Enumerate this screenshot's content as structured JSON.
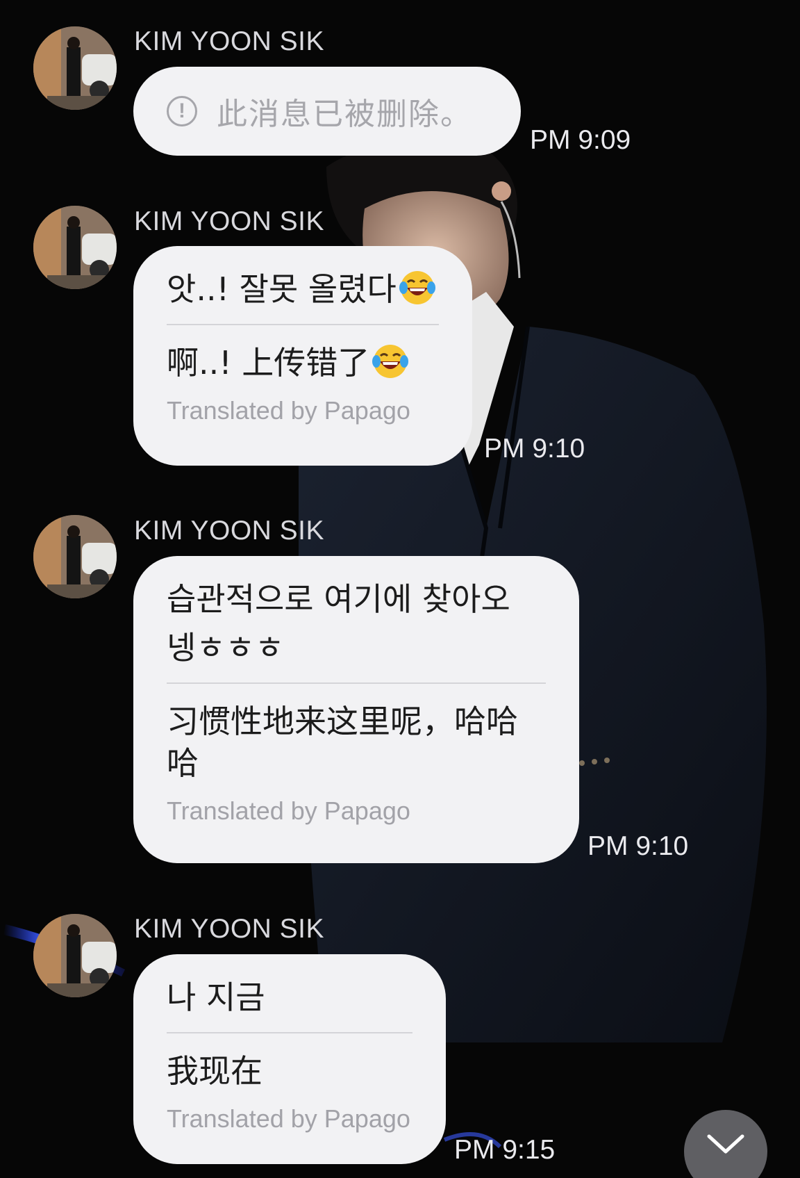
{
  "messages": [
    {
      "sender": "KIM YOON SIK",
      "deleted_text": "此消息已被删除。",
      "time": "PM 9:09"
    },
    {
      "sender": "KIM YOON SIK",
      "original": "앗..! 잘못 올렸다",
      "translated": "啊..! 上传错了",
      "credit": "Translated by Papago",
      "time": "PM 9:10"
    },
    {
      "sender": "KIM YOON SIK",
      "original_line1": "습관적으로 여기에 찾아오",
      "original_line2": "넹ㅎㅎㅎ",
      "translated_line1": "习惯性地来这里呢，哈哈",
      "translated_line2": "哈",
      "credit": "Translated by Papago",
      "time": "PM 9:10"
    },
    {
      "sender": "KIM YOON SIK",
      "original": "나 지금",
      "translated": "我现在",
      "credit": "Translated by Papago",
      "time": "PM 9:15"
    }
  ],
  "icons": {
    "deleted": "info-circle-icon",
    "emoji": "tears-of-joy-emoji",
    "scroll": "chevron-down-icon"
  },
  "colors": {
    "bubble": "#f2f2f4",
    "background": "#060606",
    "muted_text": "#a6a6ab"
  }
}
